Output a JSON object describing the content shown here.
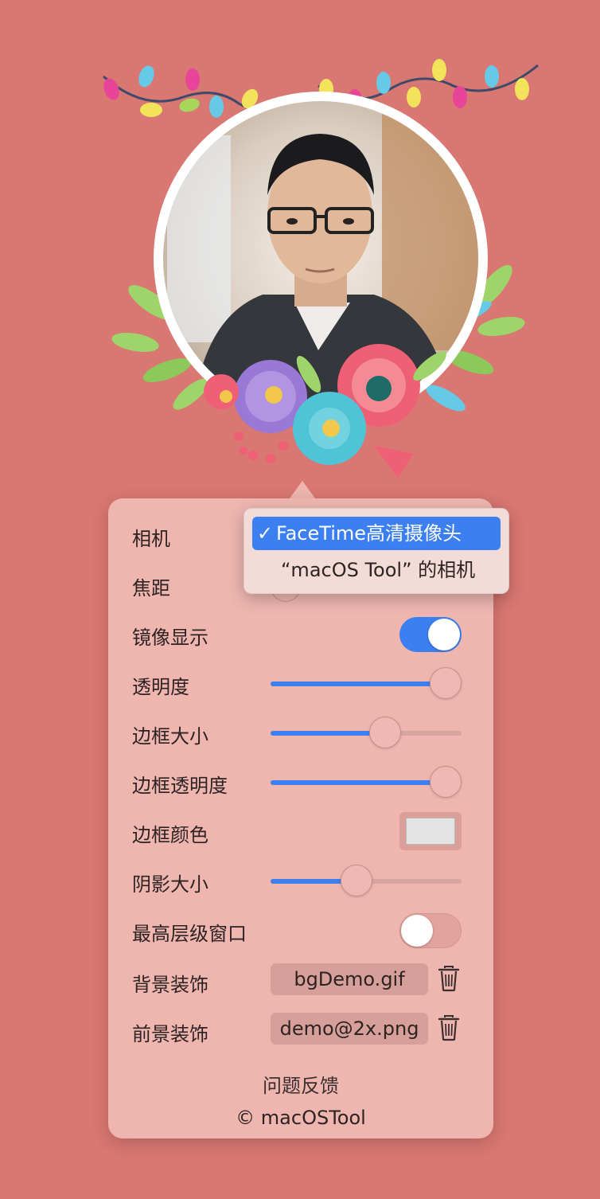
{
  "background_color": "#d97772",
  "accent_color": "#3b7ff0",
  "decoration": {
    "photo": "portrait-photo",
    "frame": "circular-white-frame",
    "garland": "string-lights-garland",
    "flowers": "floral-wreath"
  },
  "settings": {
    "camera": {
      "label": "相机",
      "options": [
        "FaceTime高清摄像头",
        "“macOS Tool” 的相机"
      ],
      "selected": "FaceTime高清摄像头"
    },
    "focal": {
      "label": "焦距"
    },
    "mirror": {
      "label": "镜像显示",
      "on": true
    },
    "opacity": {
      "label": "透明度",
      "value": 1.0
    },
    "border_size": {
      "label": "边框大小",
      "value": 0.6
    },
    "border_opacity": {
      "label": "边框透明度",
      "value": 1.0
    },
    "border_color": {
      "label": "边框颜色",
      "color": "#e3e3e3"
    },
    "shadow_size": {
      "label": "阴影大小",
      "value": 0.45
    },
    "top_level_window": {
      "label": "最高层级窗口",
      "on": false
    },
    "background_decoration": {
      "label": "背景装饰",
      "file": "bgDemo.gif"
    },
    "foreground_decoration": {
      "label": "前景装饰",
      "file": "demo@2x.png"
    }
  },
  "footer": {
    "feedback": "问题反馈",
    "copyright_symbol": "©",
    "copyright_owner": "macOSTool"
  }
}
